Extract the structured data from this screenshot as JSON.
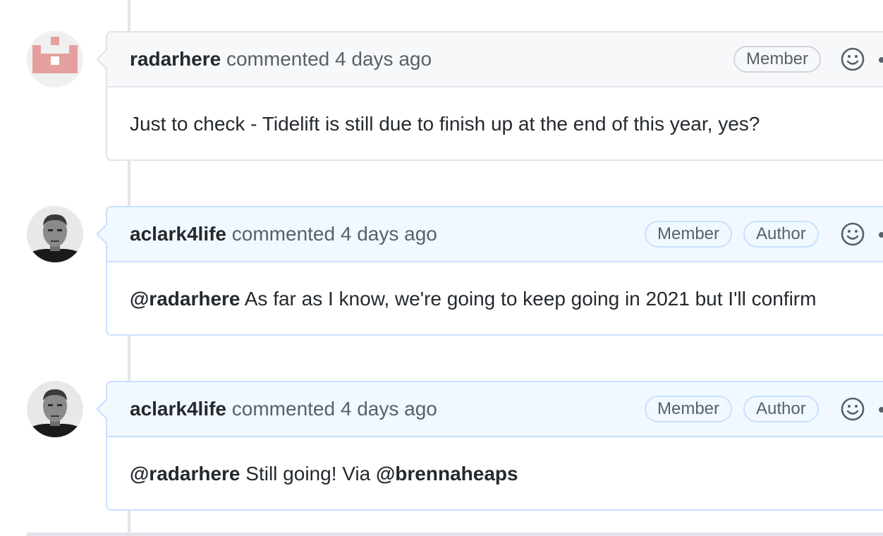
{
  "comments": [
    {
      "author": "radarhere",
      "action": "commented",
      "time": "4 days ago",
      "badges": [
        "Member"
      ],
      "avatar": "identicon-avatar",
      "body": {
        "mention": "",
        "text": "Just to check - Tidelift is still due to finish up at the end of this year, yes?",
        "mention2": ""
      }
    },
    {
      "author": "aclark4life",
      "action": "commented",
      "time": "4 days ago",
      "badges": [
        "Member",
        "Author"
      ],
      "avatar": "profile-photo-avatar",
      "body": {
        "mention": "@radarhere",
        "text": "As far as I know, we're going to keep going in 2021 but I'll confirm",
        "mention2": ""
      }
    },
    {
      "author": "aclark4life",
      "action": "commented",
      "time": "4 days ago",
      "badges": [
        "Member",
        "Author"
      ],
      "avatar": "profile-photo-avatar",
      "body": {
        "mention": "@radarhere",
        "text": "Still going! Via",
        "mention2": "@brennaheaps"
      }
    }
  ],
  "icons": {
    "reaction": "smiley-icon",
    "more": "kebab-menu-icon"
  },
  "colors": {
    "identicon": "#e4a09e",
    "highlight_border": "#c8e1ff",
    "highlight_header": "#f1f8ff",
    "header_bg": "#f6f8fa",
    "border": "#e1e4e8"
  }
}
